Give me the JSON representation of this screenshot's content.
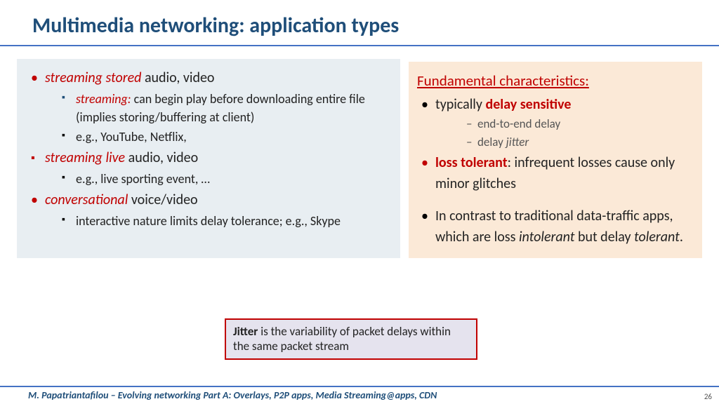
{
  "title": "Multimedia networking: application types",
  "left": {
    "i1_em": "streaming stored",
    "i1_rest": " audio, video",
    "i1a_em": "streaming:",
    "i1a_rest": " can begin play before downloading entire file (implies storing/buffering at client)",
    "i1b": "e.g., YouTube, Netflix,",
    "i2_em": "streaming live",
    "i2_rest": " audio, video",
    "i2a": "e.g., live sporting event, …",
    "i3_em": "conversational",
    "i3_rest": " voice/video",
    "i3a": "interactive nature limits delay tolerance; e.g., Skype"
  },
  "right": {
    "heading": "Fundamental characteristics:",
    "r1_pre": "typically ",
    "r1_em": "delay sensitive",
    "r1a": "end-to-end delay",
    "r1b_pre": "delay ",
    "r1b_em": "jitter",
    "r2_em": "loss tolerant",
    "r2_rest": ": infrequent losses cause only minor glitches",
    "r3_pre": "In contrast to traditional data-traffic apps, which are loss ",
    "r3_em1": "intolerant",
    "r3_mid": " but delay ",
    "r3_em2": "tolerant",
    "r3_end": "."
  },
  "jitter": {
    "b": "Jitter",
    "rest": " is the variability of packet delays within the same packet stream"
  },
  "footer": "M. Papatriantafilou –  Evolving networking Part A: Overlays, P2P apps, Media Streaming@apps, CDN",
  "page": "26"
}
